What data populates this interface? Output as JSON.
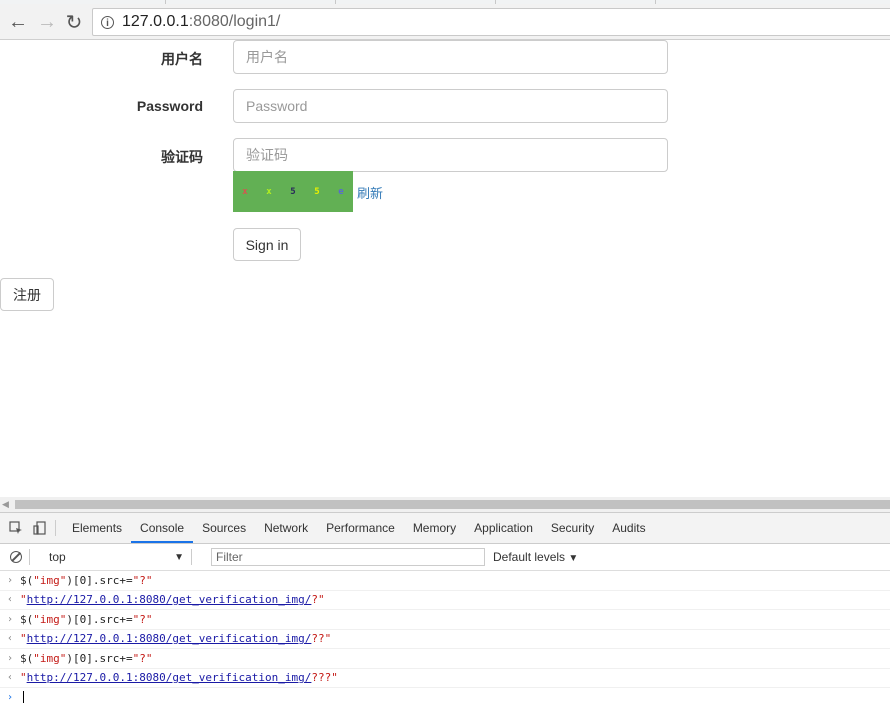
{
  "browser": {
    "url_host": "127.0.0.1",
    "url_path": ":8080/login1/"
  },
  "form": {
    "username_label": "用户名",
    "username_placeholder": "用户名",
    "password_label": "Password",
    "password_placeholder": "Password",
    "captcha_label": "验证码",
    "captcha_placeholder": "验证码",
    "captcha_chars": [
      "x",
      "x",
      "5",
      "5",
      "e"
    ],
    "refresh_label": "刷新",
    "signin_label": "Sign in",
    "register_label": "注册"
  },
  "colors": {
    "captcha_bg": "#62b054",
    "link": "#337ab7",
    "tab_active": "#1a73e8"
  },
  "devtools": {
    "tabs": [
      "Elements",
      "Console",
      "Sources",
      "Network",
      "Performance",
      "Memory",
      "Application",
      "Security",
      "Audits"
    ],
    "active_tab": "Console",
    "context": "top",
    "filter_placeholder": "Filter",
    "levels": "Default levels"
  },
  "console": [
    {
      "type": "input",
      "fn": "$(",
      "arg": "\"img\"",
      "rest": ")[0].src+=",
      "val": "\"?\""
    },
    {
      "type": "output",
      "url": "http://127.0.0.1:8080/get_verification_img/",
      "suffix": "?"
    },
    {
      "type": "input",
      "fn": "$(",
      "arg": "\"img\"",
      "rest": ")[0].src+=",
      "val": "\"?\""
    },
    {
      "type": "output",
      "url": "http://127.0.0.1:8080/get_verification_img/",
      "suffix": "??"
    },
    {
      "type": "input",
      "fn": "$(",
      "arg": "\"img\"",
      "rest": ")[0].src+=",
      "val": "\"?\""
    },
    {
      "type": "output",
      "url": "http://127.0.0.1:8080/get_verification_img/",
      "suffix": "???"
    }
  ]
}
